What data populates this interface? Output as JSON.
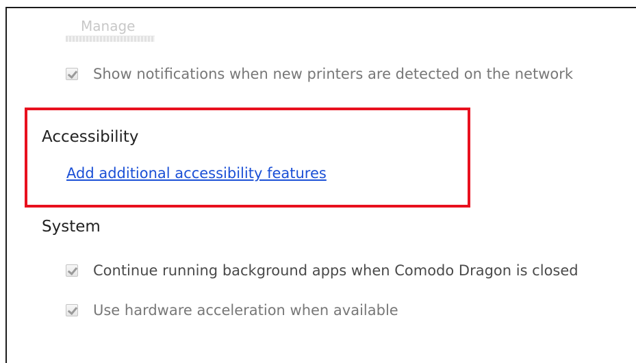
{
  "manage_button": {
    "label": "Manage"
  },
  "printers": {
    "show_notifications": {
      "label": "Show notifications when new printers are detected on the network",
      "checked": true
    }
  },
  "accessibility": {
    "heading": "Accessibility",
    "link": "Add additional accessibility features"
  },
  "system": {
    "heading": "System",
    "background_apps": {
      "label": "Continue running background apps when Comodo Dragon is closed",
      "checked": true
    },
    "hardware_acceleration": {
      "label": "Use hardware acceleration when available",
      "checked": true
    }
  },
  "colors": {
    "highlight_border": "#e8101e",
    "link": "#1a4fd6"
  },
  "icons": {
    "checkbox": "checkmark-icon"
  }
}
